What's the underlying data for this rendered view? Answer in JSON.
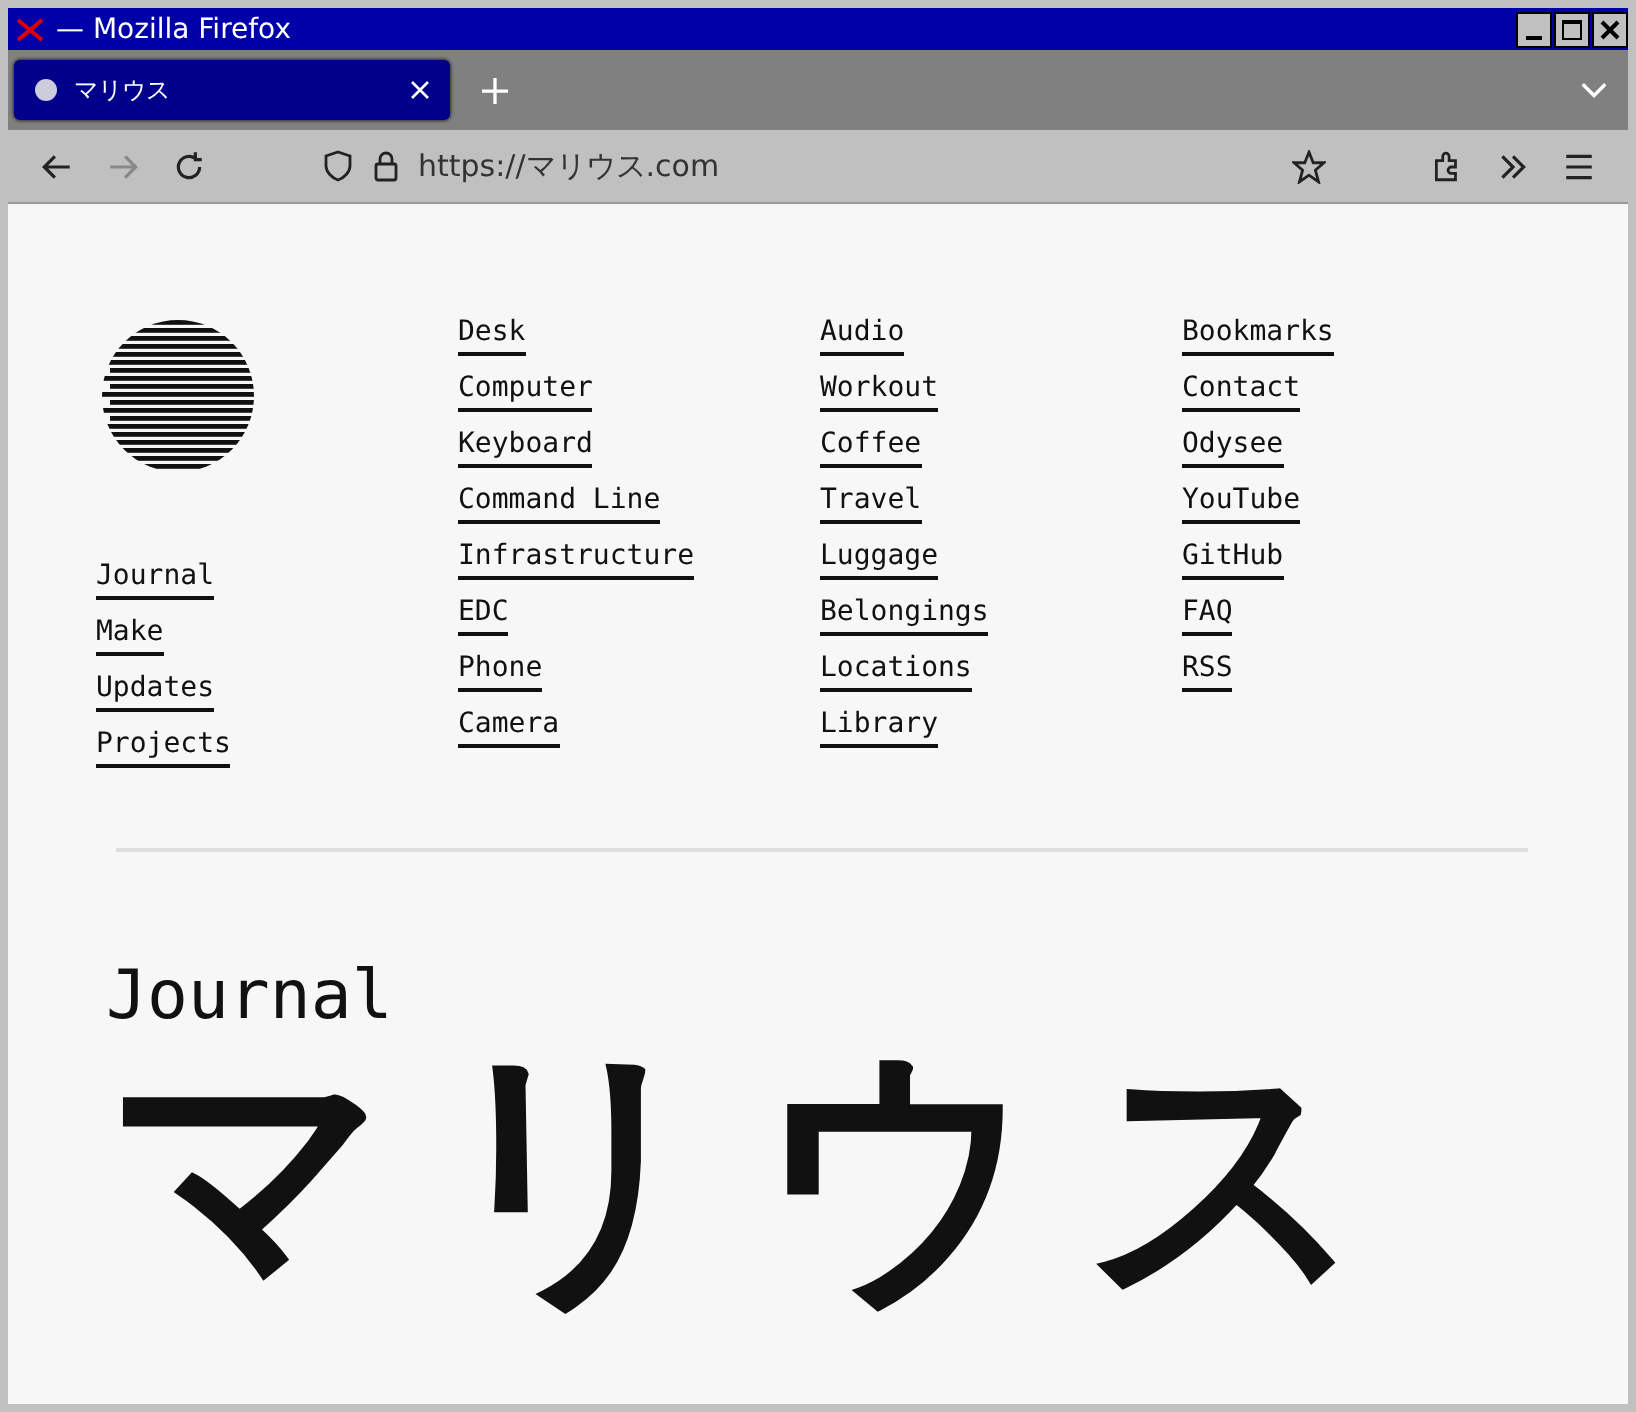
{
  "window": {
    "title": "— Mozilla Firefox"
  },
  "tabs": [
    {
      "label": "マリウス",
      "selected": true
    }
  ],
  "address_bar": {
    "url": "https://マリウス.com"
  },
  "nav_primary": [
    "Journal",
    "Make",
    "Updates",
    "Projects"
  ],
  "nav_columns": [
    [
      "Desk",
      "Computer",
      "Keyboard",
      "Command Line",
      "Infrastructure",
      "EDC",
      "Phone",
      "Camera"
    ],
    [
      "Audio",
      "Workout",
      "Coffee",
      "Travel",
      "Luggage",
      "Belongings",
      "Locations",
      "Library"
    ],
    [
      "Bookmarks",
      "Contact",
      "Odysee",
      "YouTube",
      "GitHub",
      "FAQ",
      "RSS"
    ]
  ],
  "section_title": "Journal",
  "banner_text": "マリウス"
}
